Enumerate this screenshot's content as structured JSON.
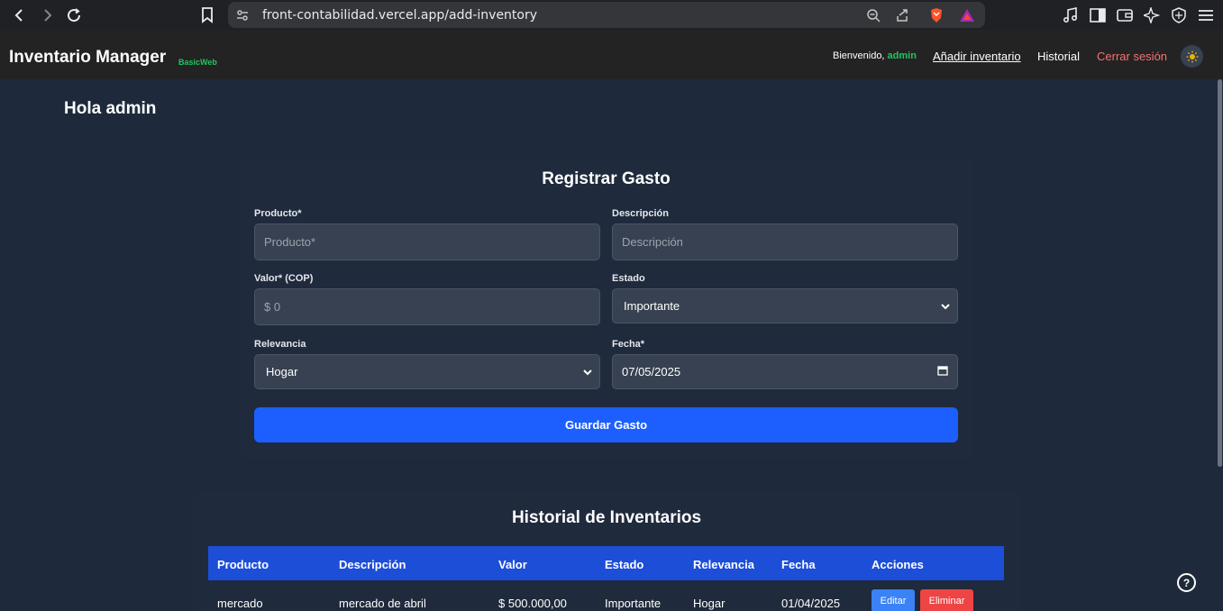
{
  "browser": {
    "url": "front-contabilidad.vercel.app/add-inventory"
  },
  "header": {
    "brand": "Inventario Manager",
    "brand_sub": "BasicWeb",
    "welcome_prefix": "Bienvenido, ",
    "welcome_user": "admin",
    "nav": {
      "add": "Añadir inventario",
      "history": "Historial",
      "logout": "Cerrar sesión"
    },
    "theme_icon": "sun-icon"
  },
  "greeting": "Hola admin",
  "form": {
    "title": "Registrar Gasto",
    "producto_label": "Producto*",
    "producto_placeholder": "Producto*",
    "descripcion_label": "Descripción",
    "descripcion_placeholder": "Descripción",
    "valor_label": "Valor* (COP)",
    "valor_placeholder": "$ 0",
    "estado_label": "Estado",
    "estado_value": "Importante",
    "relevancia_label": "Relevancia",
    "relevancia_value": "Hogar",
    "fecha_label": "Fecha*",
    "fecha_value": "07/05/2025",
    "submit": "Guardar Gasto"
  },
  "history": {
    "title": "Historial de Inventarios",
    "headers": [
      "Producto",
      "Descripción",
      "Valor",
      "Estado",
      "Relevancia",
      "Fecha",
      "Acciones"
    ],
    "rows": [
      {
        "producto": "mercado",
        "descripcion": "mercado de abril",
        "valor": "$ 500.000,00",
        "estado": "Importante",
        "relevancia": "Hogar",
        "fecha": "01/04/2025",
        "edit": "Editar",
        "delete": "Eliminar"
      }
    ]
  },
  "help": "?",
  "colors": {
    "bg": "#1e293b",
    "header_bg": "#232323",
    "accent_green": "#22c55e",
    "primary_blue": "#1d5ffe",
    "table_head": "#1d4ed8",
    "danger": "#ef4444",
    "logout": "#f87171"
  }
}
